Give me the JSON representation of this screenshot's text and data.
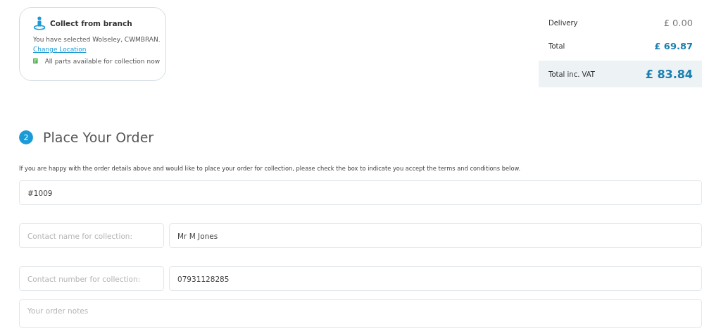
{
  "branch_card": {
    "title": "Collect from branch",
    "selected_text": "You have selected Wolseley, CWMBRAN.",
    "change_link": "Change Location",
    "availability": "All parts available for collection now"
  },
  "summary": [
    {
      "label": "Delivery",
      "value": "£ 0.00",
      "kind": "muted"
    },
    {
      "label": "Total",
      "value": "£ 69.87",
      "kind": "accent"
    },
    {
      "label": "Total inc. VAT",
      "value": "£ 83.84",
      "kind": "grand"
    }
  ],
  "section": {
    "step": "2",
    "title": "Place Your Order",
    "intro": "If you are happy with the order details above and would like to place your order for collection, please check the box to indicate you accept the terms and conditions below."
  },
  "order_reference": {
    "value": "#1009"
  },
  "contact_rows": [
    {
      "placeholder": "Contact name for collection:",
      "value": "Mr M Jones"
    },
    {
      "placeholder": "Contact number for collection:",
      "value": "07931128285"
    }
  ],
  "notes": {
    "placeholder": "Your order notes"
  }
}
